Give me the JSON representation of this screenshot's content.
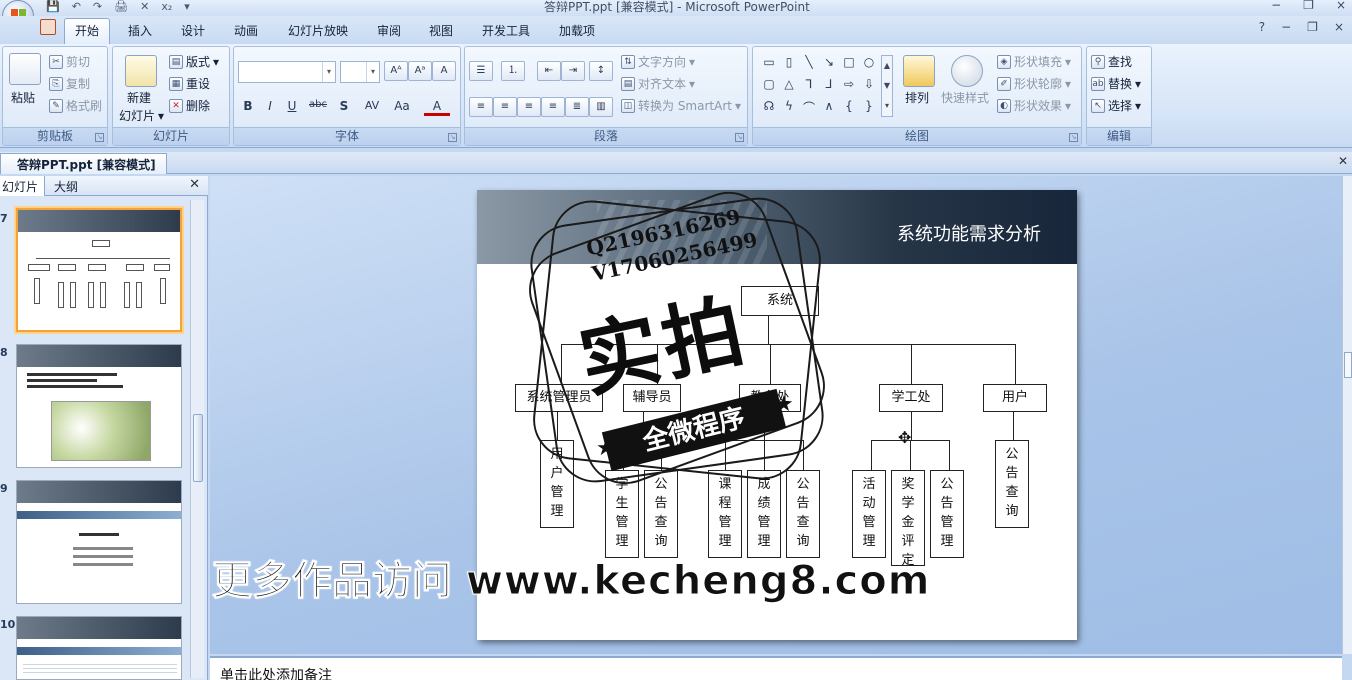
{
  "window": {
    "title": "答辩PPT.ppt [兼容模式] - Microsoft PowerPoint",
    "controls": [
      "−",
      "❐",
      "×"
    ]
  },
  "quick_access": [
    "💾",
    "↶",
    "↷",
    "🖨",
    "✕",
    "x₂",
    "▾"
  ],
  "tabs": [
    {
      "label": "开始",
      "active": true
    },
    {
      "label": "插入"
    },
    {
      "label": "设计"
    },
    {
      "label": "动画"
    },
    {
      "label": "幻灯片放映"
    },
    {
      "label": "审阅"
    },
    {
      "label": "视图"
    },
    {
      "label": "开发工具"
    },
    {
      "label": "加载项"
    }
  ],
  "ribbon": {
    "clipboard": {
      "label": "剪贴板",
      "paste": "粘贴",
      "cut": "剪切",
      "copy": "复制",
      "format_painter": "格式刷"
    },
    "slides": {
      "label": "幻灯片",
      "new_slide_1": "新建",
      "new_slide_2": "幻灯片",
      "layout": "版式",
      "reset": "重设",
      "delete": "删除"
    },
    "font": {
      "label": "字体",
      "font_name": "",
      "font_size": "",
      "grow": "A",
      "shrink": "A",
      "clear": "A",
      "bold": "B",
      "italic": "I",
      "underline": "U",
      "strike": "abc",
      "shadow": "S",
      "spacing": "AV",
      "case": "Aa",
      "color": "A"
    },
    "paragraph": {
      "label": "段落",
      "text_direction": "文字方向",
      "align_text": "对齐文本",
      "smartart": "转换为 SmartArt"
    },
    "drawing": {
      "label": "绘图",
      "arrange": "排列",
      "quick_styles": "快速样式",
      "shape_fill": "形状填充",
      "shape_outline": "形状轮廓",
      "shape_effects": "形状效果"
    },
    "editing": {
      "label": "编辑",
      "find": "查找",
      "replace": "替换",
      "select": "选择"
    }
  },
  "document_tab": "答辩PPT.ppt [兼容模式]",
  "pane": {
    "tab_slides": "幻灯片",
    "tab_outline": "大纲",
    "thumbnails": [
      {
        "num": "7",
        "selected": true
      },
      {
        "num": "8"
      },
      {
        "num": "9"
      },
      {
        "num": "10"
      }
    ]
  },
  "slide": {
    "title": "系统功能需求分析",
    "root": "系统",
    "level1": [
      "系统管理员",
      "辅导员",
      "教务处",
      "学工处",
      "用户"
    ],
    "level2": [
      "用户管理",
      "学生管理",
      "公告查询",
      "课程管理",
      "成绩管理",
      "公告查询",
      "活动管理",
      "奖学金评定",
      "公告管理",
      "公告查询"
    ]
  },
  "watermark": {
    "q_line": "Q2196316269",
    "v_line": "V17060256499",
    "big_text": "实拍",
    "band_text": "全微程序",
    "promo_text": "更多作品访问",
    "promo_url": "www.kecheng8.com"
  },
  "notes_placeholder": "单击此处添加备注"
}
